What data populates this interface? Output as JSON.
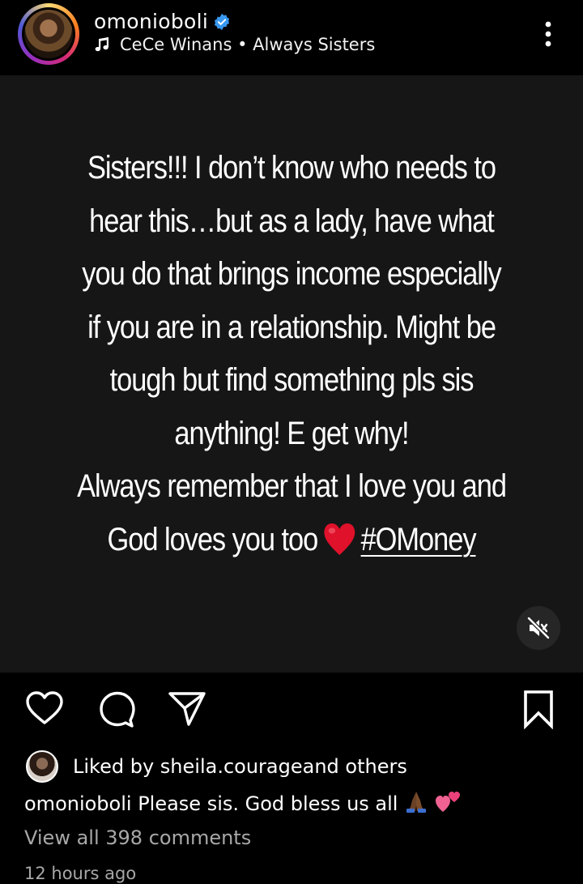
{
  "header": {
    "username": "omonioboli",
    "music_artist": "CeCe Winans",
    "music_separator": " • ",
    "music_title": "Always Sisters",
    "avatar_icon": "profile-photo",
    "verified_icon": "verified-badge-icon",
    "more_icon": "three-dots-vertical-icon",
    "ring_colors": [
      "#feda75",
      "#fa7e1e",
      "#d62976",
      "#962fbf",
      "#4f5bd5"
    ],
    "verified_color": "#3897f0"
  },
  "post": {
    "lines": [
      "Sisters!!! I don’t know who needs to",
      "hear this…but as a lady, have what",
      "you do that brings income especially",
      "if you are in a relationship. Might be",
      "tough but find something pls sis",
      "anything! E get why!",
      "Always remember that I love you and"
    ],
    "last_line_text": "God loves you too",
    "heart_emoji": "heart-emoji",
    "hashtag": "#OMoney",
    "background": "#161616",
    "mute_icon": "speaker-muted-icon"
  },
  "actions": {
    "like_icon": "heart-outline-icon",
    "comment_icon": "comment-bubble-icon",
    "share_icon": "paper-plane-icon",
    "save_icon": "bookmark-icon"
  },
  "likes": {
    "prefix": "Liked by ",
    "user": "sheila.courage",
    "suffix": " and others"
  },
  "caption": {
    "username": "omonioboli",
    "text": " Please sis. God bless us all",
    "emojis": "praying-hands-dark-skin-tone-emoji, two-hearts-emoji"
  },
  "comments": {
    "view_all": "View all 398 comments"
  },
  "timestamp": "12 hours ago"
}
